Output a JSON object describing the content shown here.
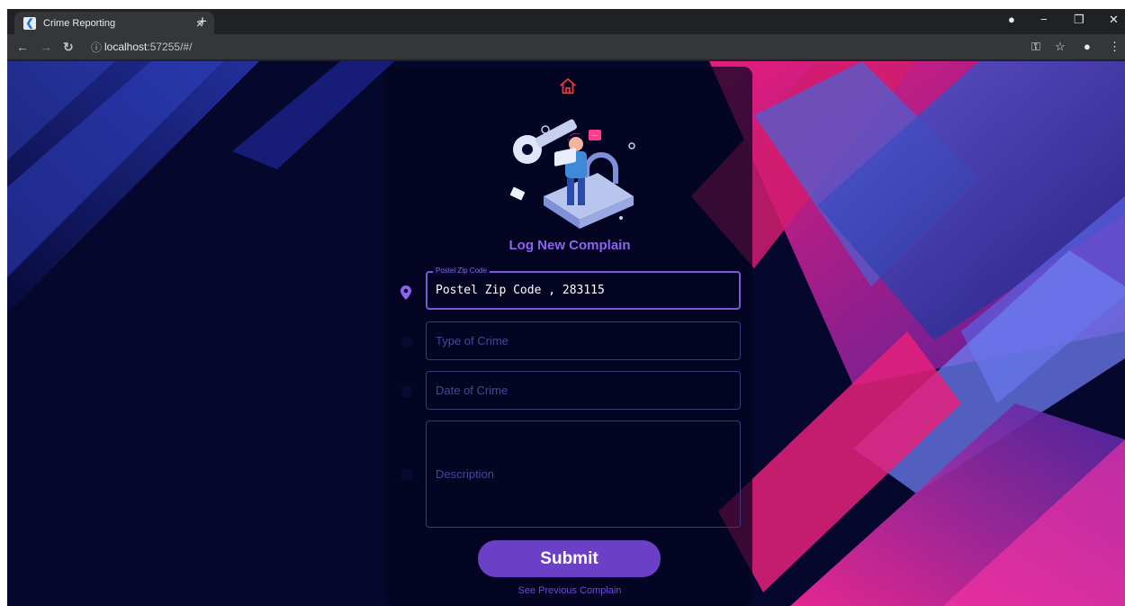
{
  "browser": {
    "tab_title": "Crime Reporting",
    "tab_close": "×",
    "new_tab": "+",
    "url_host": "localhost",
    "url_rest": ":57255/#/",
    "info_icon": "ⓘ",
    "controls": {
      "minimize": "−",
      "maximize": "❐",
      "close": "✕"
    }
  },
  "form": {
    "title": "Log New Complain",
    "zip": {
      "label": "Postel Zip Code",
      "value": "Postel Zip Code , 283115"
    },
    "crime_type": {
      "placeholder": "Type of Crime"
    },
    "crime_date": {
      "placeholder": "Date of Crime"
    },
    "description": {
      "placeholder": "Description"
    },
    "submit_label": "Submit",
    "previous_link": "See Previous Complain"
  },
  "colors": {
    "accent": "#6c40c6",
    "title": "#8e63ef",
    "field_border": "#3d3880",
    "home_icon": "#e53935",
    "background": "#06072d"
  },
  "icons": [
    "home-icon",
    "location-pin-icon",
    "key-icon",
    "laptop-icon",
    "lock-icon"
  ]
}
